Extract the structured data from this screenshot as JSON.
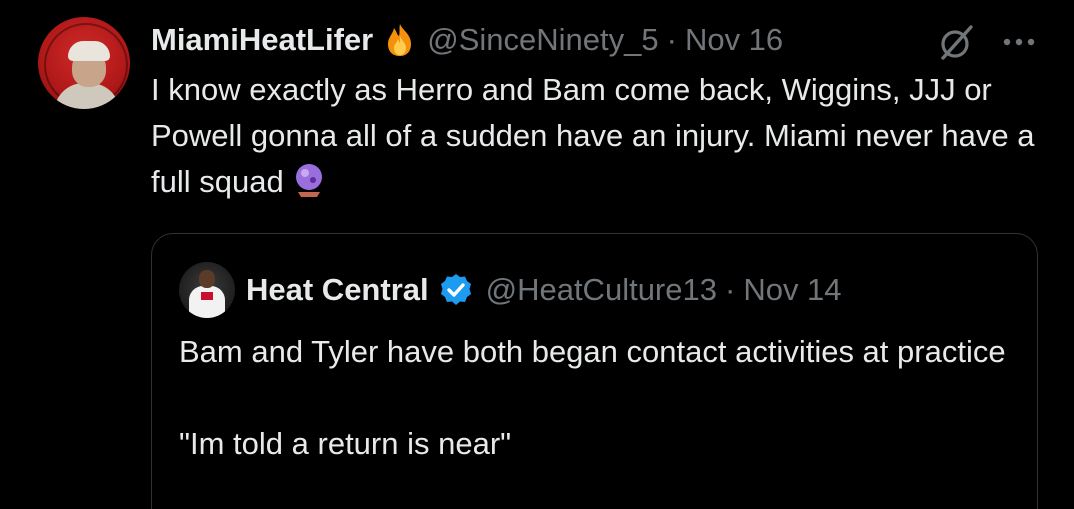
{
  "tweet": {
    "author_name": "MiamiHeatLifer",
    "author_emoji": "fire-emoji",
    "handle": "@SinceNinety_5",
    "separator": "·",
    "date": "Nov 16",
    "text": "I know exactly as Herro and Bam come back, Wiggins, JJJ or Powell gonna all of a sudden have an injury. Miami never have a full squad",
    "text_emoji": "crystal-ball-emoji"
  },
  "actions": {
    "grok_icon": "grok-icon",
    "more_icon": "more-icon"
  },
  "quoted_tweet": {
    "author_name": "Heat Central",
    "verified": "verified-badge-icon",
    "handle": "@HeatCulture13",
    "separator": "·",
    "date": "Nov 14",
    "text": "Bam and Tyler have both began contact activities at practice\n\n\"Im told a return is near\""
  },
  "colors": {
    "background": "#000000",
    "primary_text": "#e7e9ea",
    "secondary_text": "#71767b",
    "border": "#2f3336",
    "verified_blue": "#1d9bf0"
  }
}
